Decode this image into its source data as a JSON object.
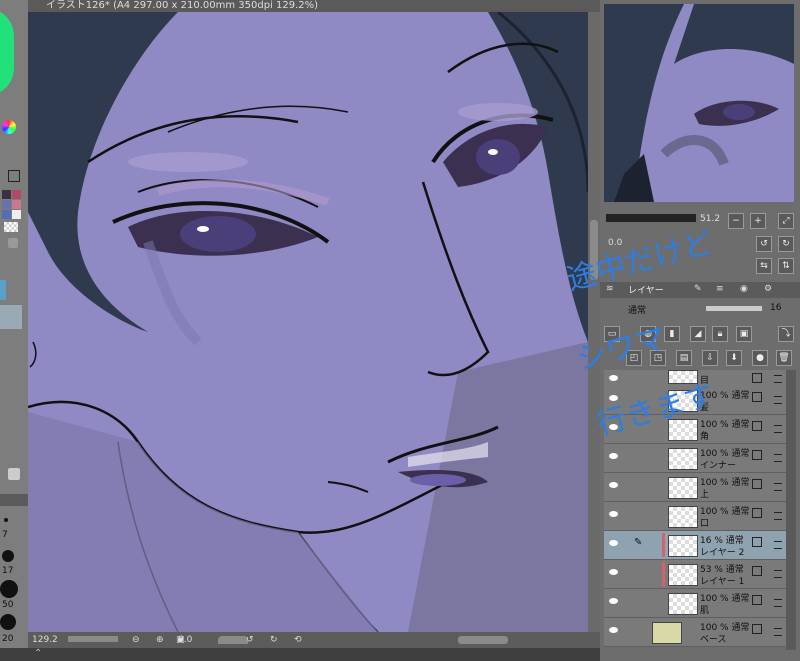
{
  "window": {
    "title": "イラスト126* (A4 297.00 x 210.00mm 350dpi 129.2%)"
  },
  "left_panel": {
    "brush_sizes": [
      "7",
      "17",
      "50",
      "20"
    ]
  },
  "status_bar": {
    "zoom": "129.2",
    "rotation": "0.0"
  },
  "navigator": {
    "zoom_value": "51.2",
    "rotation_value": "0.0"
  },
  "layer_panel": {
    "tab_label": "レイヤー",
    "blend_mode": "通常",
    "opacity": "16",
    "layers": [
      {
        "mode": "",
        "name": "目"
      },
      {
        "mode": "100 % 通常",
        "name": "髪"
      },
      {
        "mode": "100 % 通常",
        "name": "角"
      },
      {
        "mode": "100 % 通常",
        "name": "インナー"
      },
      {
        "mode": "100 % 通常",
        "name": "上"
      },
      {
        "mode": "100 % 通常",
        "name": "口"
      },
      {
        "mode": "16 % 通常",
        "name": "レイヤー 2"
      },
      {
        "mode": "53 % 通常",
        "name": "レイヤー 1"
      },
      {
        "mode": "100 % 通常",
        "name": "肌"
      },
      {
        "mode": "100 % 通常",
        "name": "ベース"
      }
    ]
  },
  "annotation": {
    "line1": "途中だけど",
    "line2": "シワマ",
    "line3": "行きます"
  },
  "colors": {
    "canvas_bg": "#8f89c4",
    "hair": "#2f3a4e",
    "handwriting": "#2f7de0",
    "selected_layer": "#8fa2b0",
    "clip_marker": "#d9606a"
  }
}
